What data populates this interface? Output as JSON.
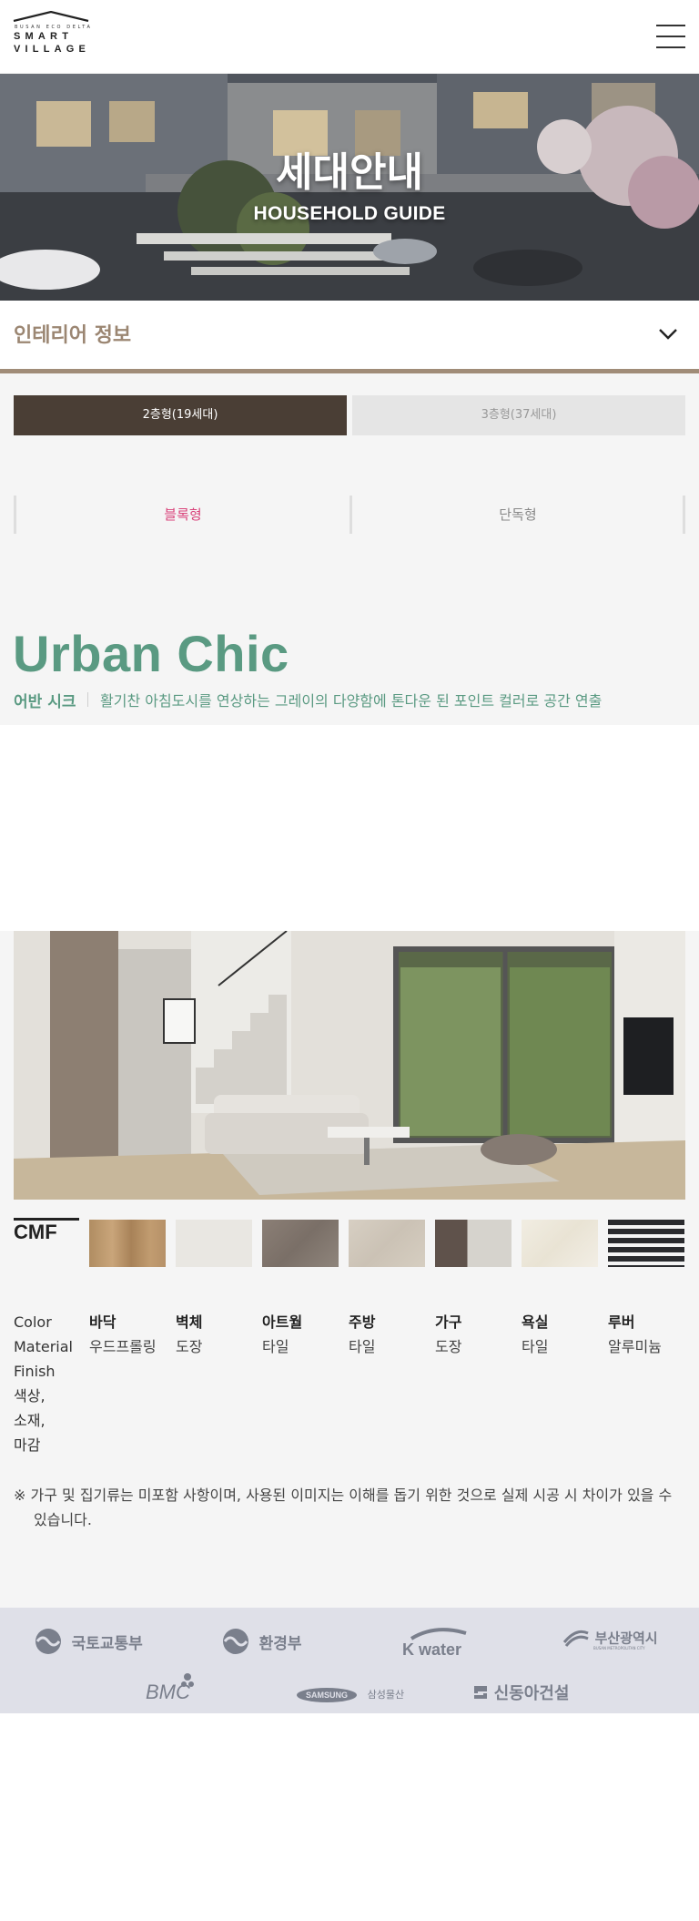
{
  "header": {
    "logo_tagline": "BUSAN ECO DELTA",
    "logo_word1": "SMART",
    "logo_word2": "VILLAGE",
    "menu_icon": "hamburger-menu-icon"
  },
  "hero": {
    "title": "세대안내",
    "subtitle": "HOUSEHOLD GUIDE"
  },
  "section": {
    "title": "인테리어 정보",
    "toggle_icon": "chevron-down-icon"
  },
  "tabs": [
    {
      "label": "2층형(19세대)",
      "active": true
    },
    {
      "label": "3층형(37세대)",
      "active": false
    }
  ],
  "types": [
    {
      "label": "블록형",
      "active": true
    },
    {
      "label": "단독형",
      "active": false
    }
  ],
  "concept": {
    "title": "Urban Chic",
    "korean_name": "어반 시크",
    "description": "활기찬 아침도시를 연상하는 그레이의 다양함에 톤다운 된 포인트 컬러로 공간 연출"
  },
  "cmf": {
    "label": "CMF",
    "left_label_lines": [
      "Color",
      "Material",
      "Finish",
      "색상,",
      "소재,",
      "마감"
    ],
    "items": [
      {
        "area": "바닥",
        "material": "우드프롤링",
        "swatch": "light-oak-wood"
      },
      {
        "area": "벽체",
        "material": "도장",
        "swatch": "off-white-paint"
      },
      {
        "area": "아트월",
        "material": "타일",
        "swatch": "taupe-stone"
      },
      {
        "area": "주방",
        "material": "타일",
        "swatch": "beige-stone"
      },
      {
        "area": "가구",
        "material": "도장",
        "swatch": "dark-brown-and-greige"
      },
      {
        "area": "욕실",
        "material": "타일",
        "swatch": "ivory-marble"
      },
      {
        "area": "루버",
        "material": "알루미늄",
        "swatch": "black-louver"
      }
    ]
  },
  "notice": "※ 가구 및 집기류는 미포함 사항이며, 사용된 이미지는 이해를 돕기 위한 것으로 실제 시공 시 차이가 있을 수 있습니다.",
  "footer_logos": [
    {
      "name": "국토교통부"
    },
    {
      "name": "환경부"
    },
    {
      "name": "K water"
    },
    {
      "name": "부산광역시",
      "sub": "BUSAN METROPOLITAN CITY"
    },
    {
      "name": "BMC"
    },
    {
      "name": "SAMSUNG",
      "sub": "삼성물산"
    },
    {
      "name": "신동아건설"
    }
  ],
  "colors": {
    "accent_brown": "#4a3e35",
    "section_brown": "#9b8672",
    "concept_green": "#5a9a82",
    "active_pink": "#d9437a",
    "footer_bg": "#dfe0e8"
  }
}
